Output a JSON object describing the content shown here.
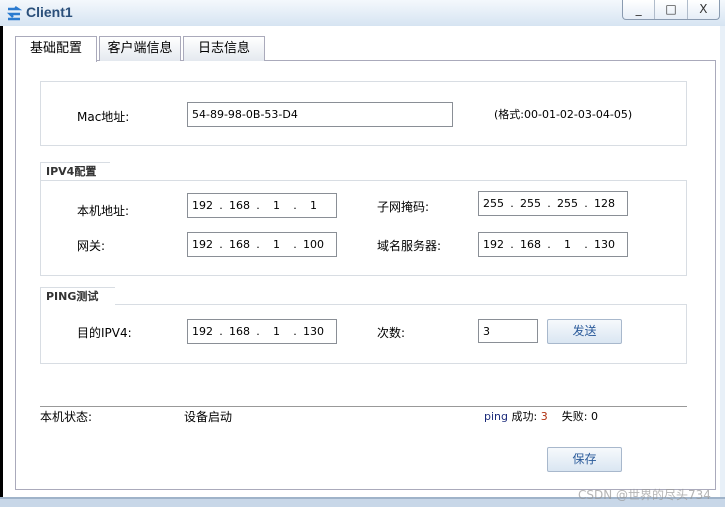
{
  "window": {
    "title": "Client1",
    "minimize": "_",
    "maximize": "□",
    "close": "X"
  },
  "tabs": [
    {
      "label": "基础配置",
      "active": true
    },
    {
      "label": "客户端信息"
    },
    {
      "label": "日志信息"
    }
  ],
  "mac": {
    "label": "Mac地址:",
    "value": "54-89-98-0B-53-D4",
    "hint": "(格式:00-01-02-03-04-05)"
  },
  "ipv4": {
    "title": "IPV4配置",
    "local_label": "本机地址:",
    "local": [
      "192",
      "168",
      "1",
      "1"
    ],
    "mask_label": "子网掩码:",
    "mask": [
      "255",
      "255",
      "255",
      "128"
    ],
    "gateway_label": "网关:",
    "gateway": [
      "192",
      "168",
      "1",
      "100"
    ],
    "dns_label": "域名服务器:",
    "dns": [
      "192",
      "168",
      "1",
      "130"
    ]
  },
  "ping": {
    "title": "PING测试",
    "dest_label": "目的IPV4:",
    "dest": [
      "192",
      "168",
      "1",
      "130"
    ],
    "count_label": "次数:",
    "count": "3",
    "send": "发送"
  },
  "status": {
    "label": "本机状态:",
    "value": "设备启动",
    "ping_label": "ping",
    "success_label": "成功:",
    "success": "3",
    "fail_label": "失败:",
    "fail": "0"
  },
  "save": "保存",
  "watermark": "CSDN @世界的尽头734"
}
